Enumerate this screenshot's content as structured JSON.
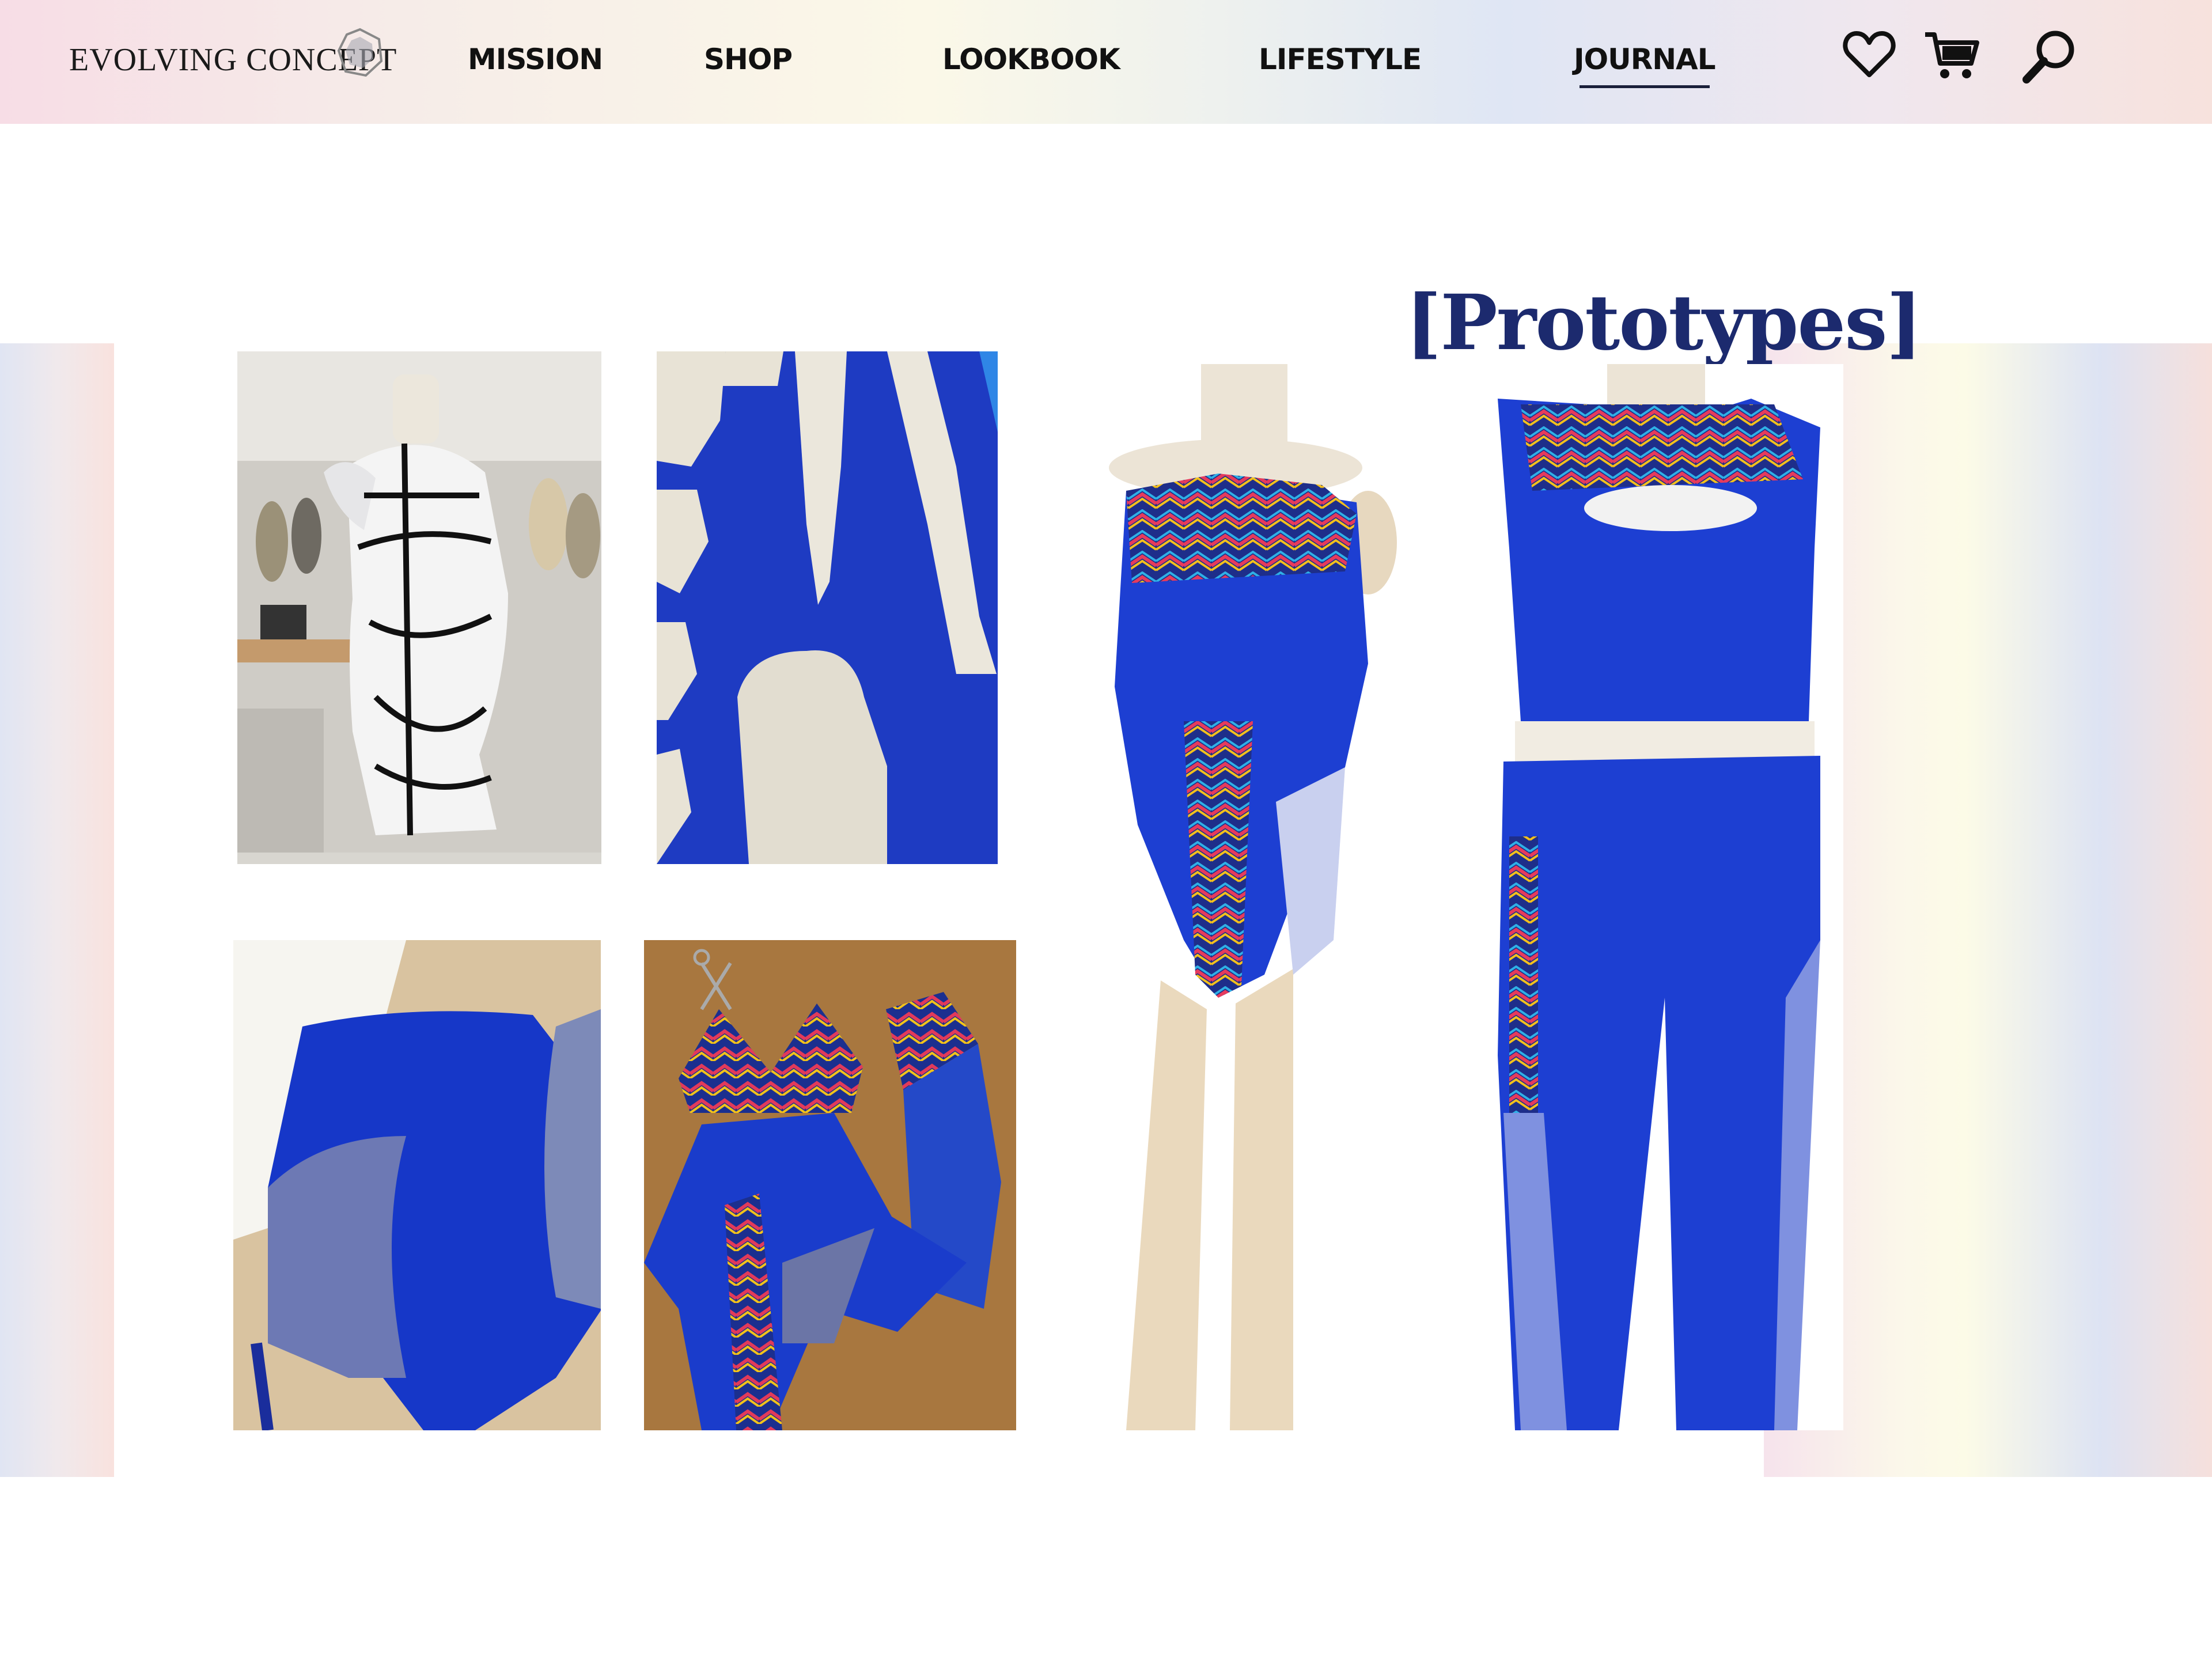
{
  "header": {
    "brand": "EVOLVING CONCEPT",
    "nav": [
      "MISSION",
      "SHOP",
      "LOOKBOOK",
      "LIFESTYLE",
      "JOURNAL"
    ],
    "active_nav": "JOURNAL",
    "icons": [
      "heart-icon",
      "cart-icon",
      "search-icon"
    ]
  },
  "page": {
    "title": "[Prototypes]"
  },
  "photos": [
    {
      "subject": "white draped bodysuit on dress form in studio"
    },
    {
      "subject": "paper patterns laid on blue fabric"
    },
    {
      "subject": "blue fabric pieces pinned with mesh on table"
    },
    {
      "subject": "cut blue and rainbow chevron pieces with scissors"
    },
    {
      "subject": "blue bodysuit with rainbow chevron panel on dress form"
    },
    {
      "subject": "blue crop top and leggings with rainbow chevron on dress form"
    }
  ],
  "colors": {
    "accent_blue": "#1f3fd0",
    "title_navy": "#1c2a6e"
  }
}
